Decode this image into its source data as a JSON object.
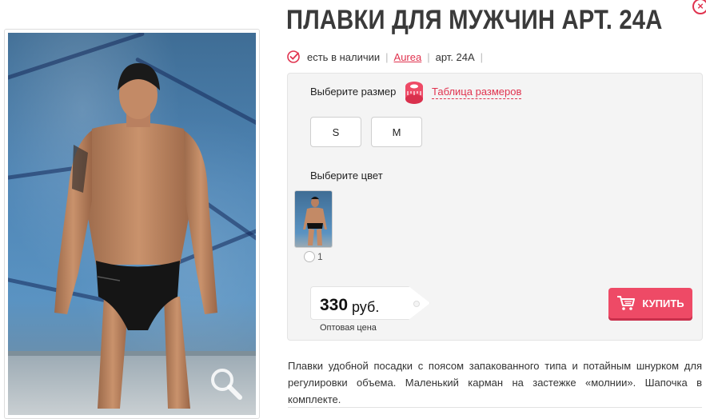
{
  "close": {
    "glyph": "×"
  },
  "product": {
    "title": "ПЛАВКИ ДЛЯ МУЖЧИН АРТ. 24А",
    "availability": "есть в наличии",
    "brand": "Aurea",
    "article": "арт. 24А"
  },
  "options": {
    "size_label": "Выберите размер",
    "size_chart_label": "Таблица размеров",
    "sizes": [
      "S",
      "M"
    ],
    "color_label": "Выберите цвет",
    "color_option_label": "1"
  },
  "price": {
    "value": "330",
    "currency": "руб.",
    "note": "Оптовая цена"
  },
  "buy": {
    "label": "КУПИТЬ"
  },
  "description": "Плавки удобной посадки с поясом запакованного типа и потайным шнурком для регулировки объема. Маленький карман на застежке «молнии». Шапочка в комплекте.",
  "colors": {
    "accent": "#e0334f",
    "buy_button": "#ee4a66",
    "panel": "#f4f4f4"
  },
  "icons": [
    "close-icon",
    "check-icon",
    "tape-measure-icon",
    "cart-icon",
    "zoom-icon"
  ]
}
